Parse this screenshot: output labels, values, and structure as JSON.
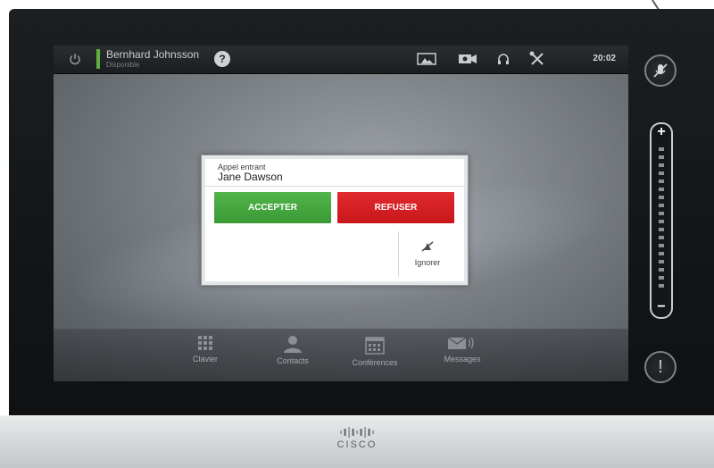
{
  "topbar": {
    "user_name": "Bernhard Johnsson",
    "user_status": "Disponible",
    "help_label": "?",
    "clock": "20:02",
    "presence_color": "#5fae3d"
  },
  "dialog": {
    "subtitle": "Appel entrant",
    "caller": "Jane Dawson",
    "accept_label": "ACCEPTER",
    "refuse_label": "REFUSER",
    "ignore_label": "Ignorer",
    "accept_color": "#3a9a36",
    "refuse_color": "#c8161b"
  },
  "dock": {
    "items": [
      {
        "label": "Clavier",
        "icon": "keypad-icon"
      },
      {
        "label": "Contacts",
        "icon": "contacts-icon"
      },
      {
        "label": "Conférences",
        "icon": "calendar-icon"
      },
      {
        "label": "Messages",
        "icon": "messages-icon"
      }
    ]
  },
  "side": {
    "volume_plus": "+",
    "volume_minus": "−",
    "info_label": "!"
  },
  "brand": {
    "logo_text": "CISCO"
  }
}
